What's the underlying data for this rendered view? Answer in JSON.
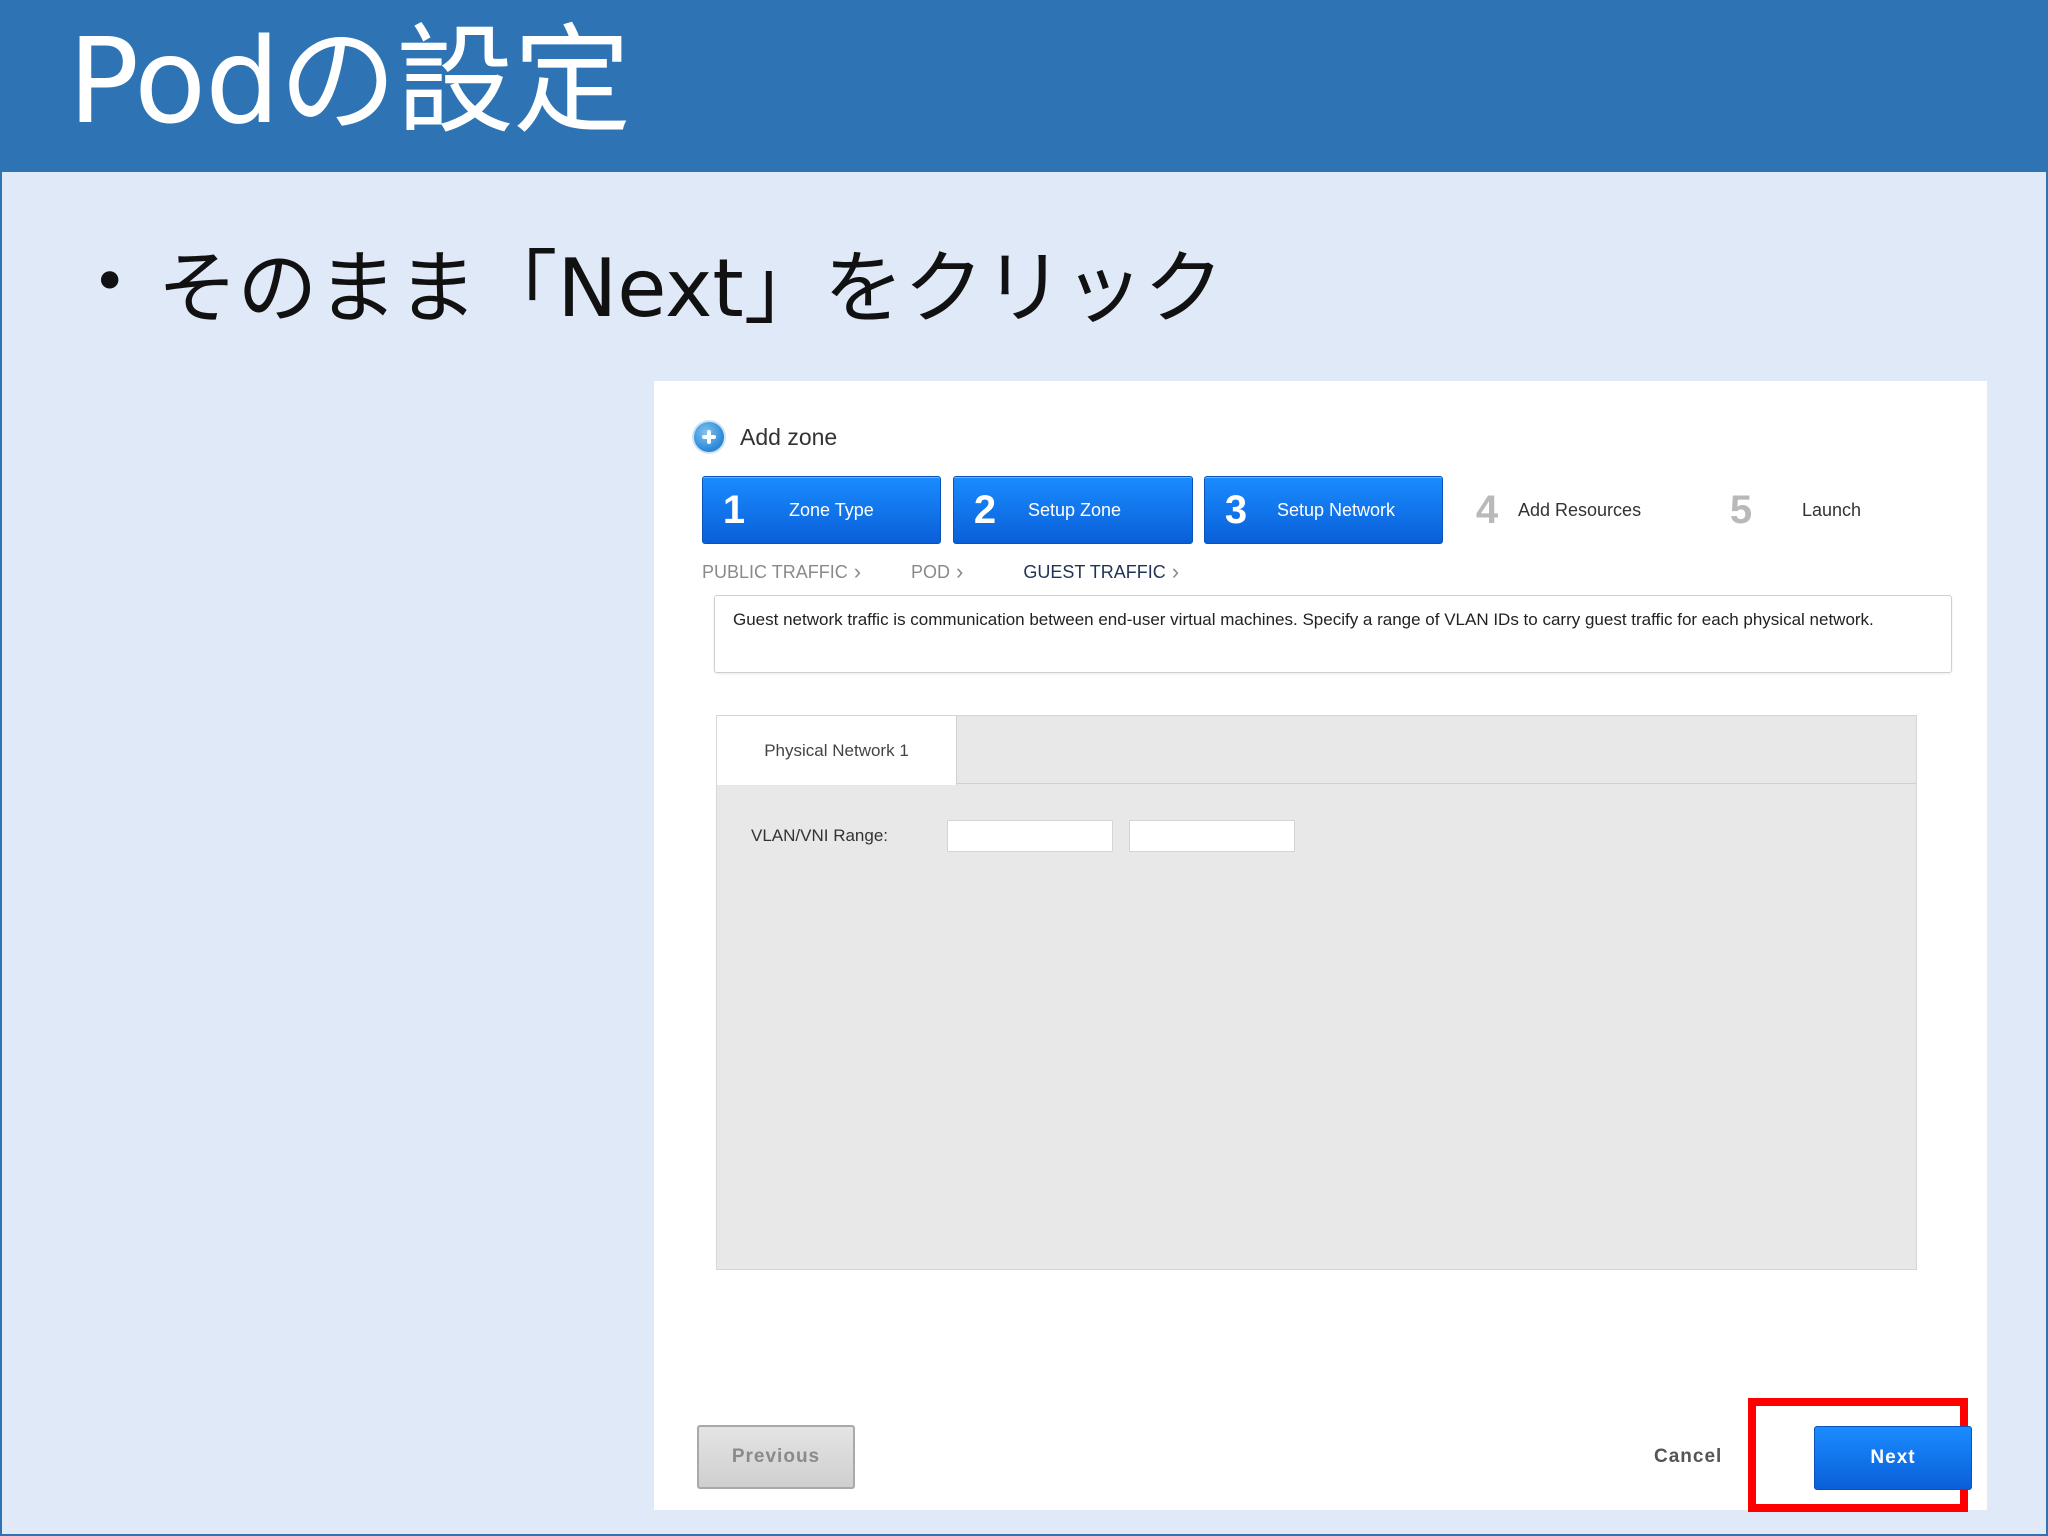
{
  "slide": {
    "title": "Podの設定",
    "bullet": "そのまま「Next」をクリック"
  },
  "wizard": {
    "title": "Add zone",
    "steps": [
      {
        "number": "1",
        "label": "Zone Type",
        "state": "active"
      },
      {
        "number": "2",
        "label": "Setup Zone",
        "state": "active"
      },
      {
        "number": "3",
        "label": "Setup Network",
        "state": "active"
      },
      {
        "number": "4",
        "label": "Add Resources",
        "state": "inactive"
      },
      {
        "number": "5",
        "label": "Launch",
        "state": "inactive"
      }
    ],
    "breadcrumb": [
      "PUBLIC TRAFFIC",
      "POD",
      "GUEST TRAFFIC"
    ],
    "info": "Guest network traffic is communication between end-user virtual machines. Specify a range of VLAN IDs to carry guest traffic for each physical network.",
    "tab_label": "Physical Network 1",
    "range_label": "VLAN/VNI Range:",
    "range_start": "",
    "range_end": "",
    "previous_label": "Previous",
    "cancel_label": "Cancel",
    "next_label": "Next"
  },
  "colors": {
    "header_bg": "#2e74b5",
    "slide_bg": "#dfe9f7",
    "active_step": "#0a6fe8",
    "highlight": "#ff0000"
  }
}
